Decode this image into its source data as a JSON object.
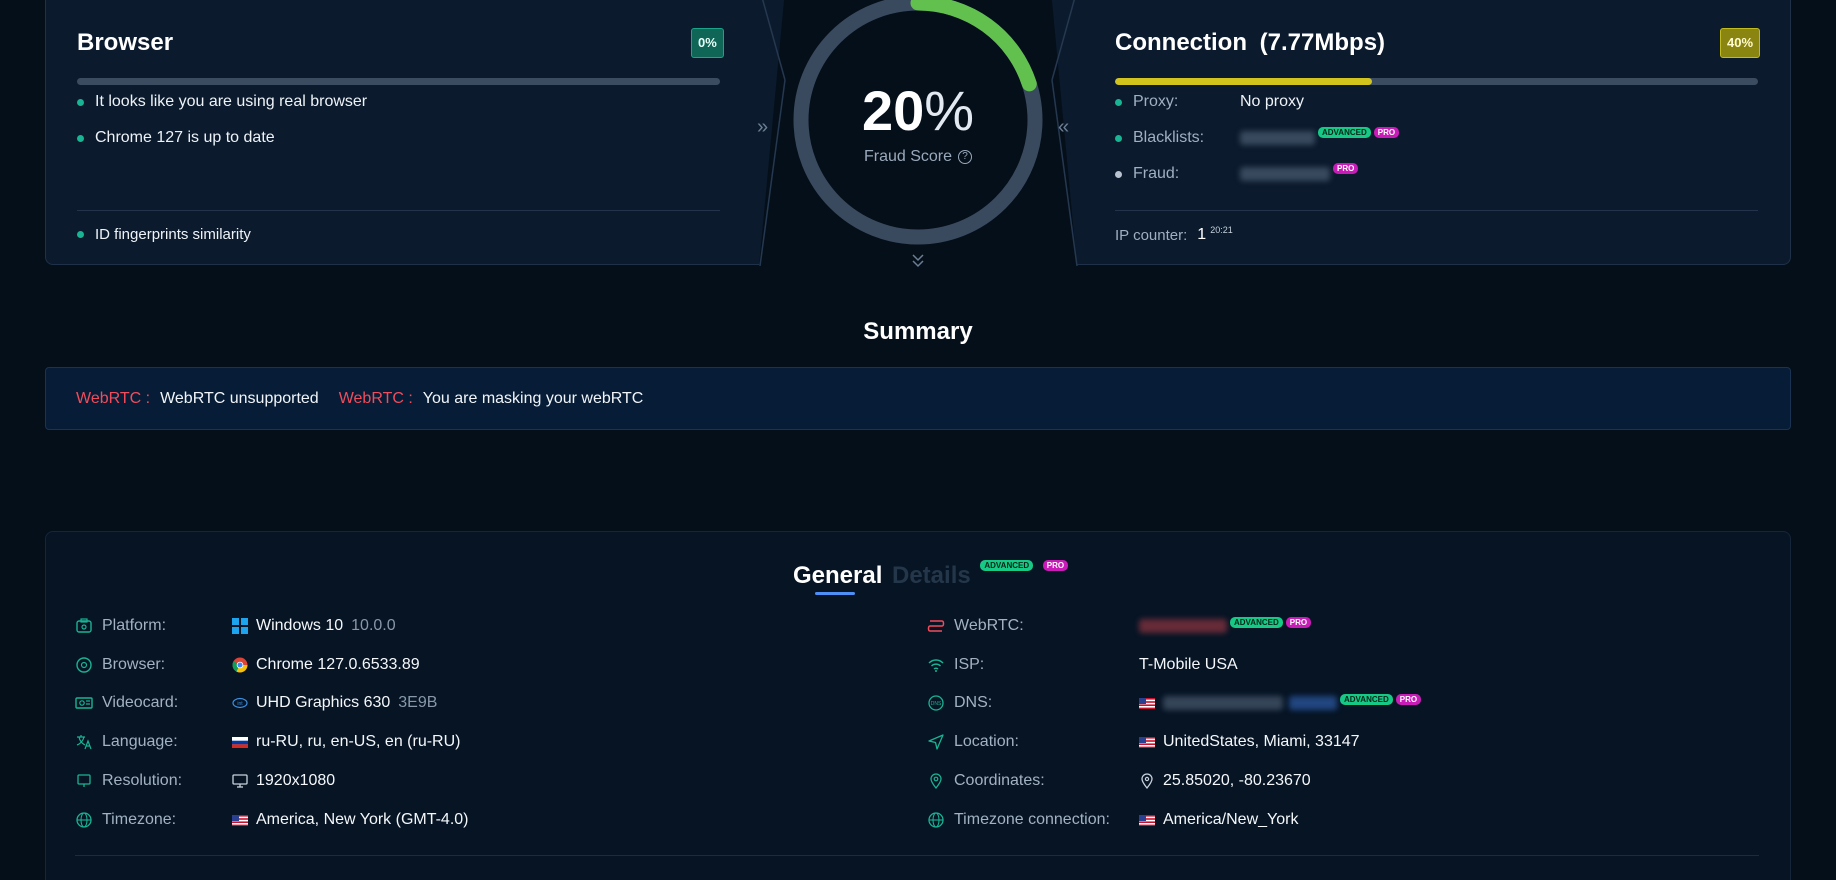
{
  "browser_panel": {
    "title": "Browser",
    "badge": "0%",
    "checks": [
      "It looks like you are using real browser",
      "Chrome 127 is up to date"
    ],
    "footer": "ID fingerprints similarity"
  },
  "connection_panel": {
    "title": "Connection",
    "speed": "(7.77Mbps)",
    "badge": "40%",
    "progress_fraction": 0.4,
    "proxy_label": "Proxy:",
    "proxy_value": "No proxy",
    "blacklists_label": "Blacklists:",
    "fraud_label": "Fraud:",
    "ip_counter_label": "IP counter:",
    "ip_counter_value": "1",
    "ip_counter_time": "20:21"
  },
  "gauge": {
    "value": "20",
    "percent_sign": "%",
    "label": "Fraud Score",
    "help": "?",
    "fraction": 0.2
  },
  "tags": {
    "advanced": "ADVANCED",
    "pro": "PRO"
  },
  "summary": {
    "title": "Summary",
    "items": [
      {
        "key": "WebRTC :",
        "value": "WebRTC unsupported"
      },
      {
        "key": "WebRTC :",
        "value": "You are masking your webRTC"
      }
    ]
  },
  "tabs": {
    "general": "General",
    "details": "Details"
  },
  "general_left": [
    {
      "label": "Platform:",
      "value": "Windows 10",
      "sub": "10.0.0"
    },
    {
      "label": "Browser:",
      "value": "Chrome 127.0.6533.89"
    },
    {
      "label": "Videocard:",
      "value": "UHD Graphics 630",
      "sub": "3E9B"
    },
    {
      "label": "Language:",
      "value": "ru-RU, ru, en-US, en (ru-RU)"
    },
    {
      "label": "Resolution:",
      "value": "1920x1080"
    },
    {
      "label": "Timezone:",
      "value": "America, New York (GMT-4.0)"
    }
  ],
  "general_right": [
    {
      "label": "WebRTC:"
    },
    {
      "label": "ISP:",
      "value": "T-Mobile USA"
    },
    {
      "label": "DNS:"
    },
    {
      "label": "Location:",
      "value": "UnitedStates, Miami, 33147"
    },
    {
      "label": "Coordinates:",
      "value": "25.85020, -80.23670"
    },
    {
      "label": "Timezone connection:",
      "value": "America/New_York"
    }
  ],
  "colors": {
    "background": "#040f1a",
    "panel": "#0b1a2c",
    "accent_green": "#1ab394",
    "gauge_arc": "#62c04f",
    "warning_red": "#f04c5c",
    "yellow": "#d2c31d",
    "tab_blue": "#4d8ef7"
  },
  "icons": {
    "platform": "platform-icon",
    "browser": "browser-icon",
    "videocard": "videocard-icon",
    "language": "language-icon",
    "resolution": "monitor-icon",
    "timezone": "globe-icon",
    "webrtc": "webrtc-icon",
    "isp": "wifi-icon",
    "dns": "dns-icon",
    "location": "location-arrow-icon",
    "coordinates": "map-pin-icon"
  }
}
